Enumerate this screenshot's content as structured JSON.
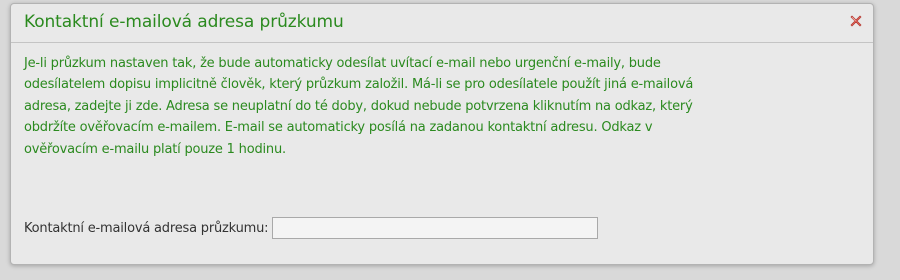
{
  "dialog": {
    "title": "Kontaktní e-mailová adresa průzkumu",
    "close_icon": "close-x-icon",
    "description": "Je-li průzkum nastaven tak, že bude automaticky odesílat uvítací e-mail nebo urgenční e-maily, bude odesílatelem dopisu implicitně člověk, který průzkum založil. Má-li se pro odesílatele použít jiná e-mailová adresa, zadejte ji zde. Adresa se neuplatní do té doby, dokud nebude potvrzena kliknutím na odkaz, který obdržíte ověřovacím e-mailem. E-mail se automaticky posílá na zadanou kontaktní adresu. Odkaz v ověřovacím e-mailu platí pouze 1 hodinu.",
    "field_label": "Kontaktní e-mailová adresa průzkumu:",
    "field_value": ""
  },
  "colors": {
    "accent_green": "#2b8a1f",
    "close_red": "#d9534f"
  }
}
